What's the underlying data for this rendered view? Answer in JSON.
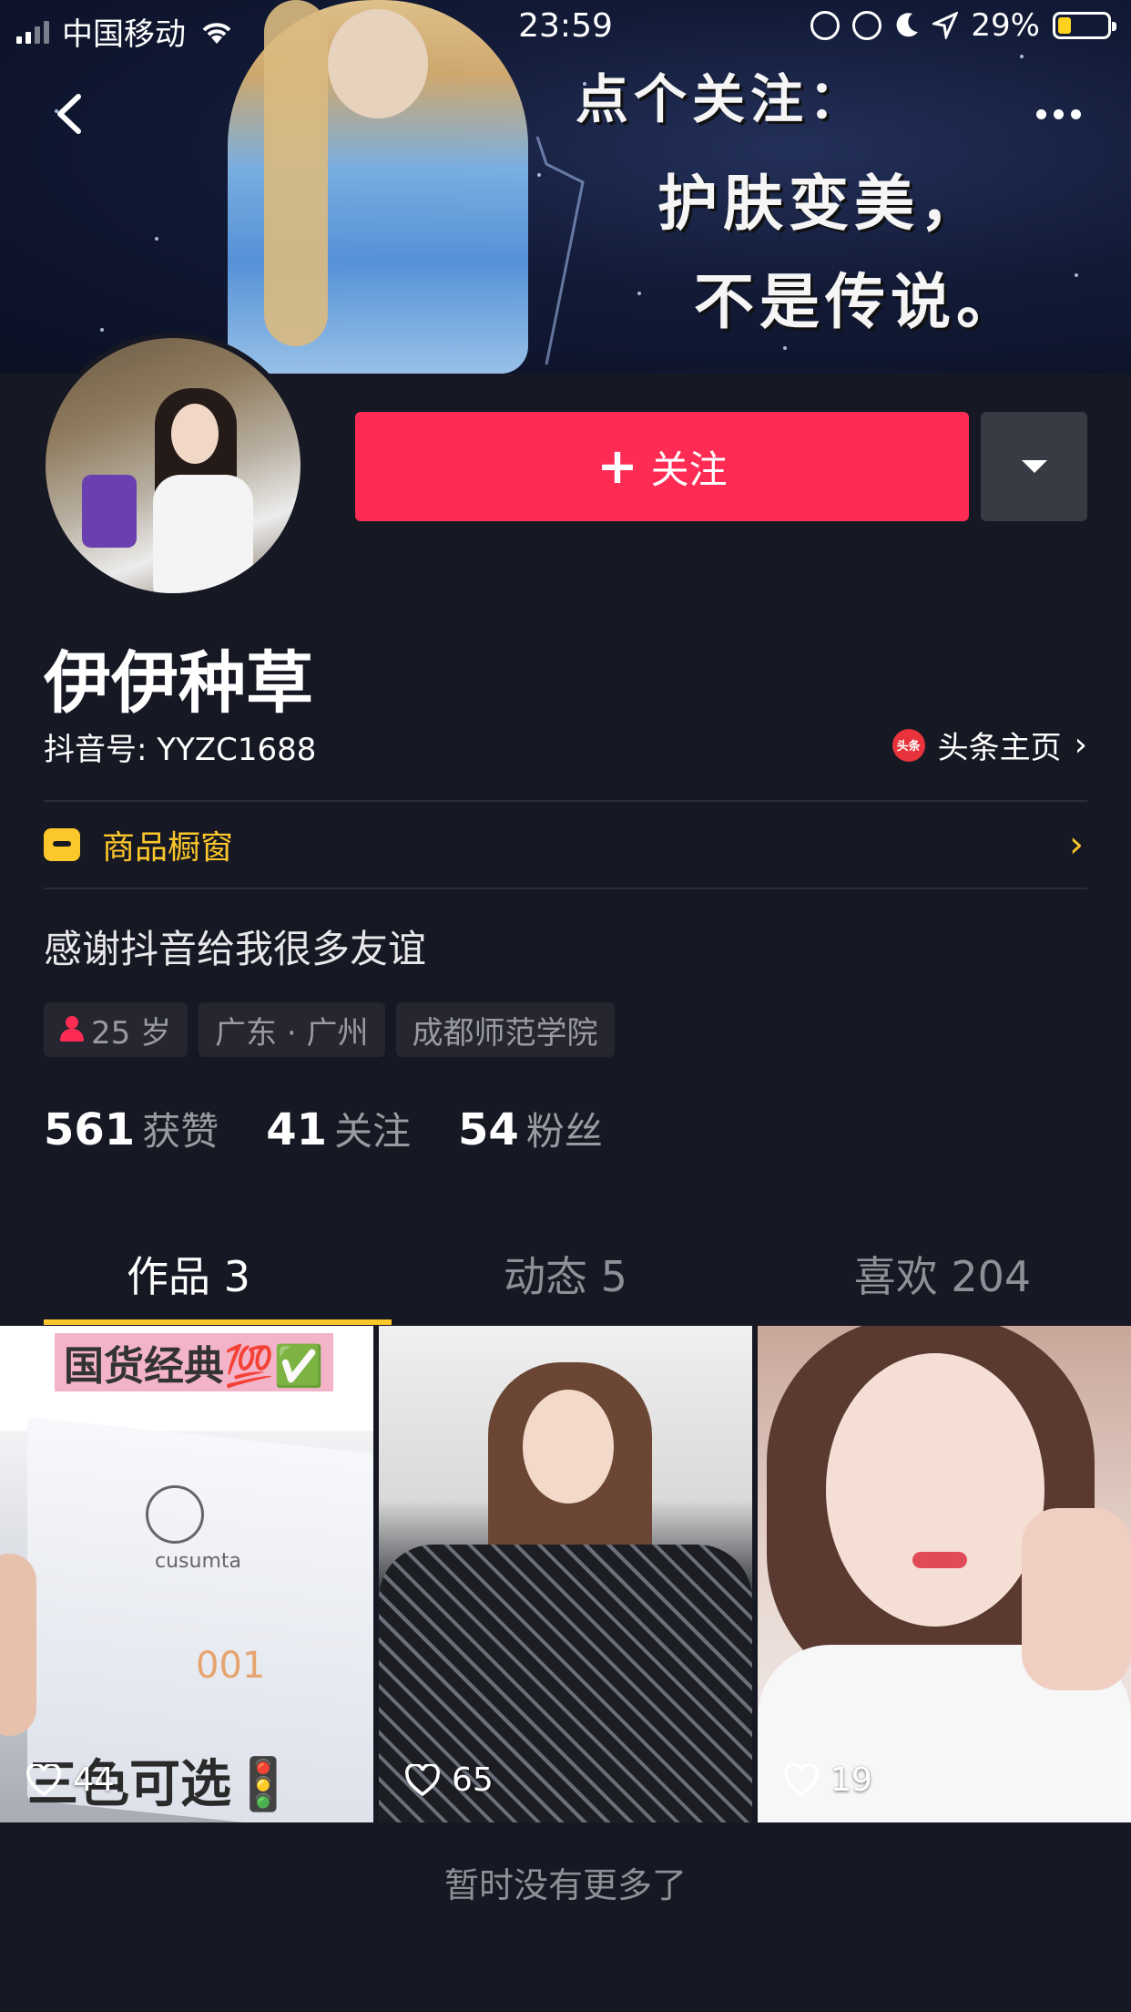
{
  "status_bar": {
    "carrier": "中国移动",
    "time": "23:59",
    "battery": "29%"
  },
  "banner": {
    "line1": "点个关注：",
    "line2": "护肤变美，",
    "line3": "不是传说。"
  },
  "profile": {
    "follow_label": "关注",
    "username": "伊伊种草",
    "douyin_id": "抖音号: YYZC1688",
    "toutiao_icon_text": "头条",
    "toutiao_label": "头条主页",
    "shop_label": "商品橱窗",
    "bio": "感谢抖音给我很多友谊",
    "tags": [
      "25 岁",
      "广东 · 广州",
      "成都师范学院"
    ]
  },
  "stats": [
    {
      "num": "561",
      "label": "获赞"
    },
    {
      "num": "41",
      "label": "关注"
    },
    {
      "num": "54",
      "label": "粉丝"
    }
  ],
  "tabs": [
    {
      "label": "作品 3",
      "active": true
    },
    {
      "label": "动态 5",
      "active": false
    },
    {
      "label": "喜欢 204",
      "active": false
    }
  ],
  "videos": [
    {
      "likes": "44",
      "top_text": "国货经典💯✅",
      "brand": "cusumta",
      "product_code": "001",
      "bottom_text": "三色可选🚦"
    },
    {
      "likes": "65"
    },
    {
      "likes": "19"
    }
  ],
  "end_message": "暂时没有更多了",
  "colors": {
    "background": "#161823",
    "accent": "#fe2c55",
    "shop": "#fcc72b"
  }
}
